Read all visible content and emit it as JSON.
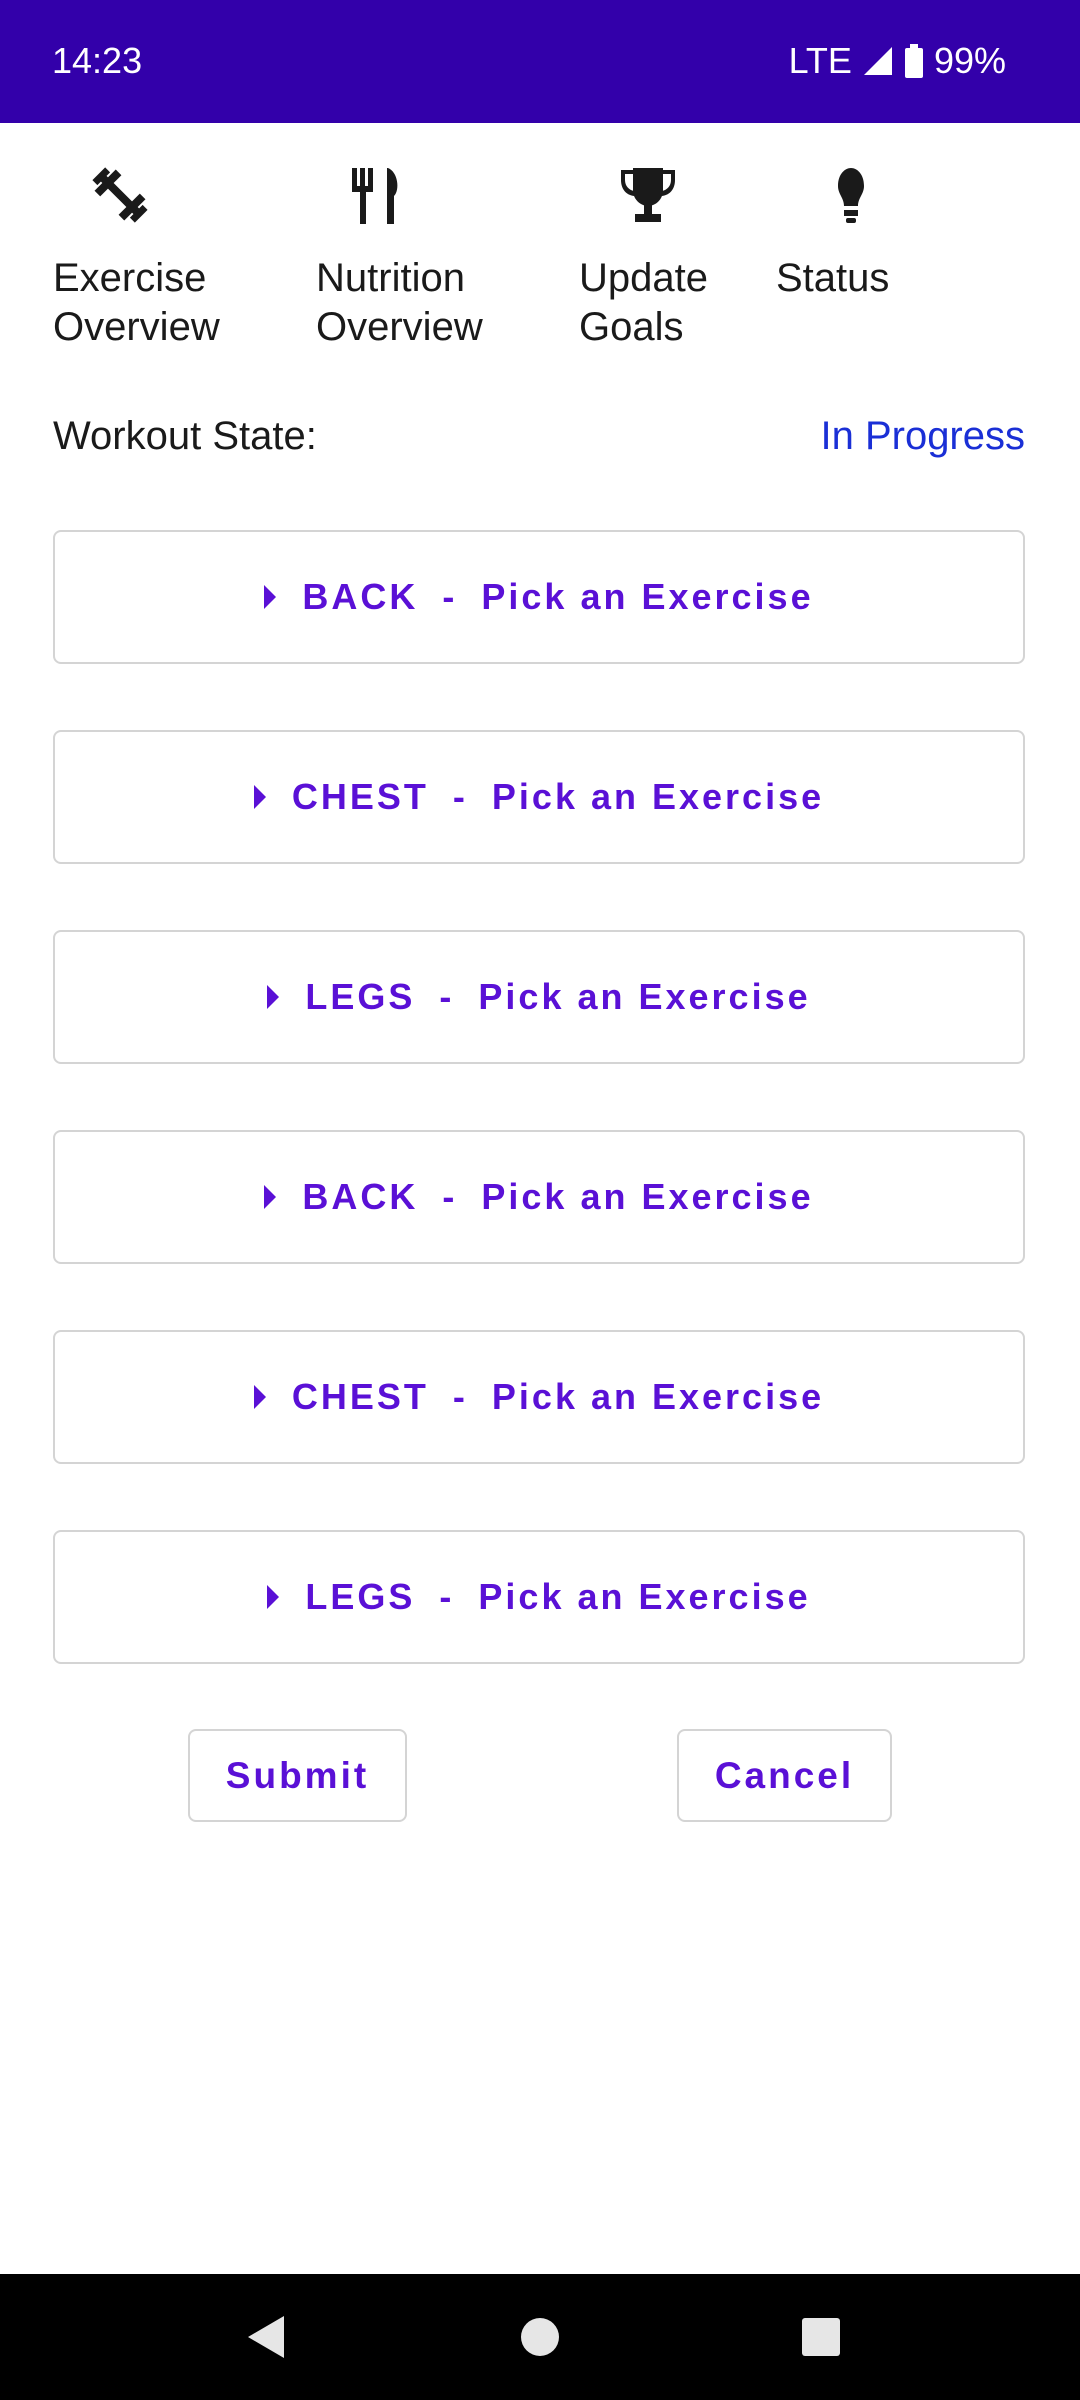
{
  "status_bar": {
    "time": "14:23",
    "network": "LTE",
    "battery": "99%",
    "background_color": "#3300aa"
  },
  "nav": {
    "items": [
      {
        "label": "Exercise\nOverview",
        "icon": "dumbbell-icon"
      },
      {
        "label": "Nutrition\nOverview",
        "icon": "fork-knife-icon"
      },
      {
        "label": "Update\nGoals",
        "icon": "trophy-icon"
      },
      {
        "label": "Status",
        "icon": "lightbulb-icon"
      }
    ]
  },
  "workout": {
    "state_label": "Workout State:",
    "state_value": "In Progress",
    "state_value_color": "#1a2fd6"
  },
  "groups": [
    {
      "name": "BACK",
      "separator": "-",
      "action": "Pick an Exercise"
    },
    {
      "name": "CHEST",
      "separator": "-",
      "action": "Pick an Exercise"
    },
    {
      "name": "LEGS",
      "separator": "-",
      "action": "Pick an Exercise"
    },
    {
      "name": "BACK",
      "separator": "-",
      "action": "Pick an Exercise"
    },
    {
      "name": "CHEST",
      "separator": "-",
      "action": "Pick an Exercise"
    },
    {
      "name": "LEGS",
      "separator": "-",
      "action": "Pick an Exercise"
    }
  ],
  "actions": {
    "submit": "Submit",
    "cancel": "Cancel",
    "accent_color": "#5a10d6"
  }
}
